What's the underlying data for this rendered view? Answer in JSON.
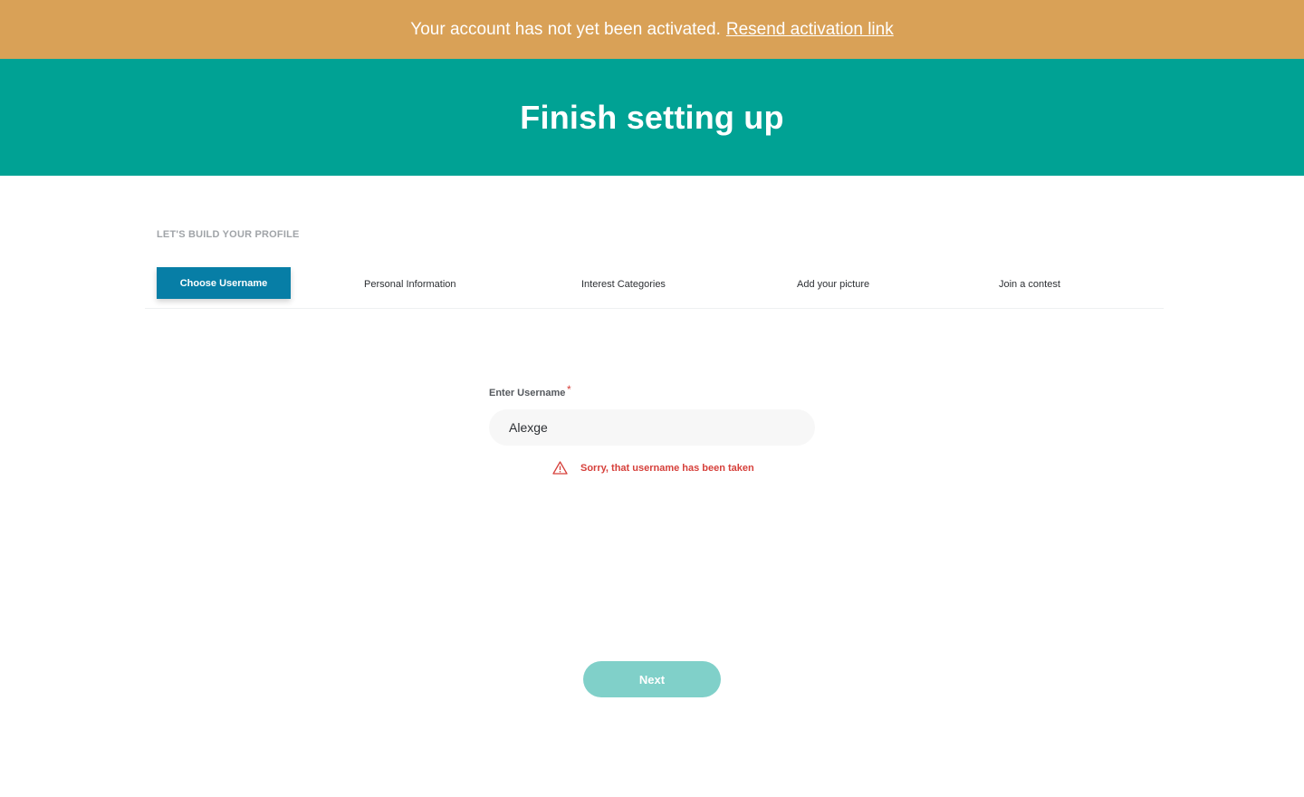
{
  "banner": {
    "message": "Your account has not yet been activated.",
    "link_label": "Resend activation link",
    "background": "#d9a157"
  },
  "hero": {
    "title": "Finish setting up",
    "background": "#00a294"
  },
  "profile": {
    "section_label": "LET'S BUILD YOUR PROFILE",
    "steps": [
      {
        "label": "Choose Username",
        "active": true
      },
      {
        "label": "Personal Information",
        "active": false
      },
      {
        "label": "Interest Categories",
        "active": false
      },
      {
        "label": "Add your picture",
        "active": false
      },
      {
        "label": "Join a contest",
        "active": false
      }
    ],
    "active_color": "#077ea6"
  },
  "form": {
    "username_label": "Enter Username",
    "required_marker": "*",
    "username_value": "Alexge",
    "error_message": "Sorry, that username has been taken",
    "error_icon": "warning-triangle-icon",
    "error_color": "#d6403b"
  },
  "actions": {
    "next_label": "Next",
    "next_color": "#80d0c9"
  }
}
